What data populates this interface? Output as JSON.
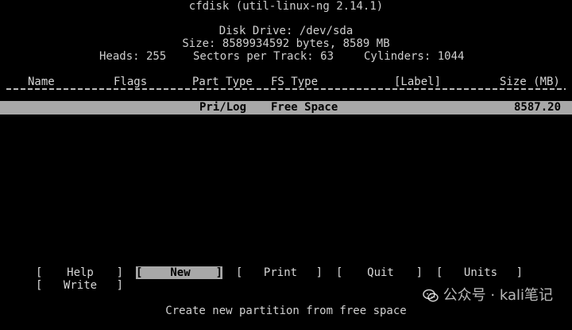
{
  "header": {
    "app_title": "cfdisk (util-linux-ng 2.14.1)",
    "disk_drive": "Disk Drive: /dev/sda",
    "size": "Size: 8589934592 bytes, 8589 MB",
    "heads_label": "Heads: 255",
    "sectors_label": "Sectors per Track: 63",
    "cylinders_label": "Cylinders: 1044"
  },
  "table": {
    "columns": [
      "Name",
      "Flags",
      "Part Type",
      "FS Type",
      "[Label]",
      "Size (MB)"
    ],
    "rows": [
      {
        "name": "",
        "flags": "",
        "part_type": "Pri/Log",
        "fs_type": "Free Space",
        "label": "",
        "size_mb": "8587.20"
      }
    ]
  },
  "menu": {
    "items": [
      "Help",
      "New",
      "Print",
      "Quit",
      "Units",
      "Write"
    ],
    "selected": "New",
    "open_bracket": "[",
    "close_bracket": "]"
  },
  "status": {
    "message": "Create new partition from free space"
  },
  "watermark": {
    "text": "公众号 · kali笔记"
  },
  "colors": {
    "background": "#000000",
    "text": "#cfcfcf",
    "selection_bg": "#a8a8a8",
    "selection_text": "#000000"
  },
  "icons": {
    "watermark_icon": "wechat-icon"
  }
}
